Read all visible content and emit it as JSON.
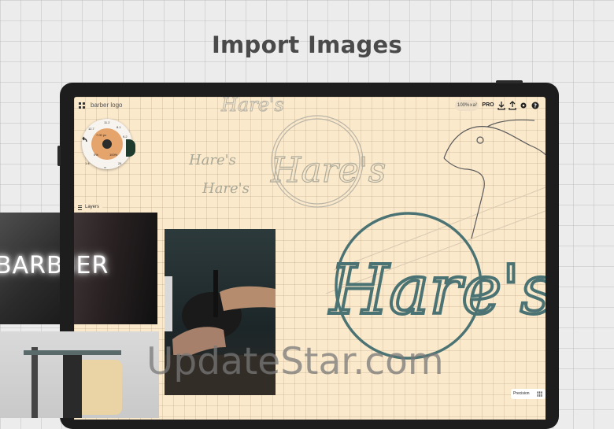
{
  "headline": "Import Images",
  "document": {
    "title": "barber logo"
  },
  "toolbar": {
    "zoom": "100%",
    "zoom_close": "x",
    "zoom_unit": "a²",
    "pro_label": "PRO",
    "icons": [
      "export-icon",
      "share-icon",
      "settings-icon",
      "help-icon"
    ]
  },
  "brush_wheel": {
    "size": "7.00 px",
    "opacity_left": "0%",
    "opacity_right": "100%",
    "labels": [
      "11.2",
      "12.7",
      "8.1",
      "9.2",
      "1.4",
      "24",
      "∞"
    ]
  },
  "layers_button": "Layers",
  "precision_button": "Precision",
  "neon_sign": "BARBER",
  "sketch_words": [
    "Hare's",
    "Hare's",
    "Hare's",
    "Hare's"
  ],
  "watermark": "UpdateStar.com",
  "colors": {
    "canvas": "#fbe9cc",
    "logo_teal": "#4b7373",
    "brush_orange": "#e6a46d",
    "brush_green": "#1e3b2e"
  }
}
